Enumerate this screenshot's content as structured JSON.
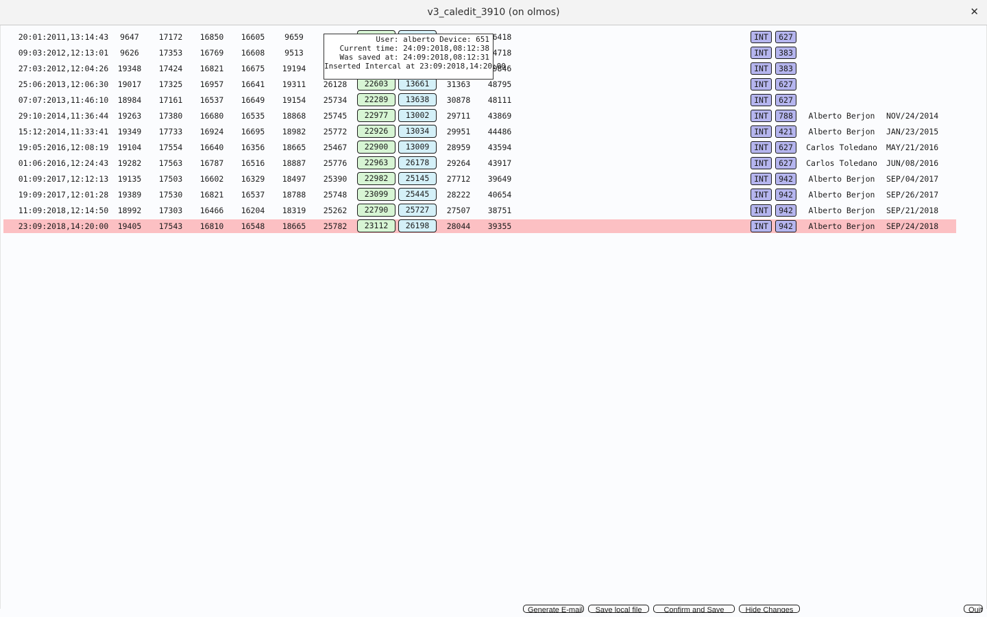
{
  "window": {
    "title": "v3_caledit_3910 (on olmos)",
    "close_glyph": "✕"
  },
  "tooltip": {
    "lines": [
      "User: alberto Device: 651",
      "Current time: 24:09:2018,08:12:38",
      "Was saved at: 24:09:2018,08:12:31",
      "Inserted Intercal at 23:09:2018,14:20:00"
    ]
  },
  "rows": [
    {
      "date": "20:01:2011,13:14:43",
      "v1": "9647",
      "v2": "17172",
      "v3": "16850",
      "v4": "16605",
      "v5": "9659",
      "v6": "",
      "b1": "",
      "b2": "",
      "v7": "",
      "v8": "56418",
      "tag": "INT",
      "code": "627",
      "user": "",
      "saved": ""
    },
    {
      "date": "09:03:2012,12:13:01",
      "v1": "9626",
      "v2": "17353",
      "v3": "16769",
      "v4": "16608",
      "v5": "9513",
      "v6": "",
      "b1": "",
      "b2": "",
      "v7": "",
      "v8": "54718",
      "tag": "INT",
      "code": "383",
      "user": "",
      "saved": ""
    },
    {
      "date": "27:03:2012,12:04:26",
      "v1": "19348",
      "v2": "17424",
      "v3": "16821",
      "v4": "16675",
      "v5": "19194",
      "v6": "",
      "b1": "",
      "b2": "",
      "v7": "",
      "v8": "49846",
      "tag": "INT",
      "code": "383",
      "user": "",
      "saved": ""
    },
    {
      "date": "25:06:2013,12:06:30",
      "v1": "19017",
      "v2": "17325",
      "v3": "16957",
      "v4": "16641",
      "v5": "19311",
      "v6": "26128",
      "b1": "22603",
      "b2": "13661",
      "v7": "31363",
      "v8": "48795",
      "tag": "INT",
      "code": "627",
      "user": "",
      "saved": ""
    },
    {
      "date": "07:07:2013,11:46:10",
      "v1": "18984",
      "v2": "17161",
      "v3": "16537",
      "v4": "16649",
      "v5": "19154",
      "v6": "25734",
      "b1": "22289",
      "b2": "13638",
      "v7": "30878",
      "v8": "48111",
      "tag": "INT",
      "code": "627",
      "user": "",
      "saved": ""
    },
    {
      "date": "29:10:2014,11:36:44",
      "v1": "19263",
      "v2": "17380",
      "v3": "16680",
      "v4": "16535",
      "v5": "18868",
      "v6": "25745",
      "b1": "22977",
      "b2": "13002",
      "v7": "29711",
      "v8": "43869",
      "tag": "INT",
      "code": "788",
      "user": "Alberto Berjon",
      "saved": "NOV/24/2014"
    },
    {
      "date": "15:12:2014,11:33:41",
      "v1": "19349",
      "v2": "17733",
      "v3": "16924",
      "v4": "16695",
      "v5": "18982",
      "v6": "25772",
      "b1": "22926",
      "b2": "13034",
      "v7": "29951",
      "v8": "44486",
      "tag": "INT",
      "code": "421",
      "user": "Alberto Berjon",
      "saved": "JAN/23/2015"
    },
    {
      "date": "19:05:2016,12:08:19",
      "v1": "19104",
      "v2": "17554",
      "v3": "16640",
      "v4": "16356",
      "v5": "18665",
      "v6": "25467",
      "b1": "22900",
      "b2": "13009",
      "v7": "28959",
      "v8": "43594",
      "tag": "INT",
      "code": "627",
      "user": "Carlos Toledano",
      "saved": "MAY/21/2016"
    },
    {
      "date": "01:06:2016,12:24:43",
      "v1": "19282",
      "v2": "17563",
      "v3": "16787",
      "v4": "16516",
      "v5": "18887",
      "v6": "25776",
      "b1": "22963",
      "b2": "26178",
      "v7": "29264",
      "v8": "43917",
      "tag": "INT",
      "code": "627",
      "user": "Carlos Toledano",
      "saved": "JUN/08/2016"
    },
    {
      "date": "01:09:2017,12:12:13",
      "v1": "19135",
      "v2": "17503",
      "v3": "16602",
      "v4": "16329",
      "v5": "18497",
      "v6": "25390",
      "b1": "22982",
      "b2": "25145",
      "v7": "27712",
      "v8": "39649",
      "tag": "INT",
      "code": "942",
      "user": "Alberto Berjon",
      "saved": "SEP/04/2017"
    },
    {
      "date": "19:09:2017,12:01:28",
      "v1": "19389",
      "v2": "17530",
      "v3": "16821",
      "v4": "16537",
      "v5": "18788",
      "v6": "25748",
      "b1": "23099",
      "b2": "25445",
      "v7": "28222",
      "v8": "40654",
      "tag": "INT",
      "code": "942",
      "user": "Alberto Berjon",
      "saved": "SEP/26/2017"
    },
    {
      "date": "11:09:2018,12:14:50",
      "v1": "18992",
      "v2": "17303",
      "v3": "16466",
      "v4": "16204",
      "v5": "18319",
      "v6": "25262",
      "b1": "22790",
      "b2": "25727",
      "v7": "27507",
      "v8": "38751",
      "tag": "INT",
      "code": "942",
      "user": "Alberto Berjon",
      "saved": "SEP/21/2018"
    },
    {
      "date": "23:09:2018,14:20:00",
      "v1": "19405",
      "v2": "17543",
      "v3": "16810",
      "v4": "16548",
      "v5": "18665",
      "v6": "25782",
      "b1": "23112",
      "b2": "26198",
      "v7": "28044",
      "v8": "39355",
      "tag": "INT",
      "code": "942",
      "user": "Alberto Berjon",
      "saved": "SEP/24/2018"
    }
  ],
  "highlight_color": "#fcc0c3",
  "buttons": {
    "email": "Generate E-mail",
    "save_local": "Save local file",
    "confirm": "Confirm and Save",
    "hide": "Hide Changes",
    "quit": "Quit"
  }
}
